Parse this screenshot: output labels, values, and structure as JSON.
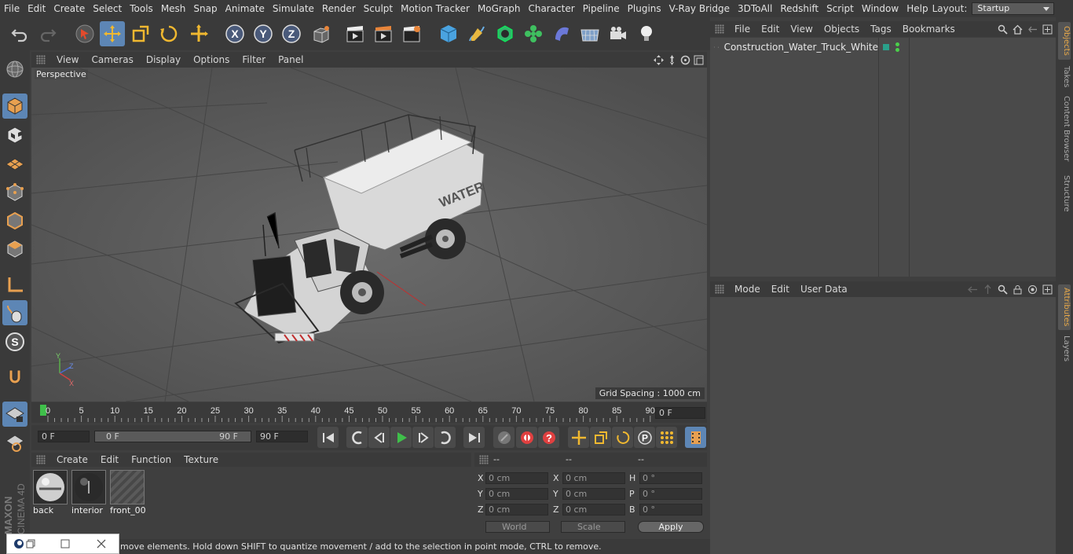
{
  "menu": [
    "File",
    "Edit",
    "Create",
    "Select",
    "Tools",
    "Mesh",
    "Snap",
    "Animate",
    "Simulate",
    "Render",
    "Sculpt",
    "Motion Tracker",
    "MoGraph",
    "Character",
    "Pipeline",
    "Plugins",
    "V-Ray Bridge",
    "3DToAll",
    "Redshift",
    "Script",
    "Window",
    "Help"
  ],
  "layout": {
    "label": "Layout:",
    "value": "Startup"
  },
  "viewport": {
    "menu": [
      "View",
      "Cameras",
      "Display",
      "Options",
      "Filter",
      "Panel"
    ],
    "camera_label": "Perspective",
    "grid_spacing": "Grid Spacing : 1000 cm",
    "tank_text": "WATER"
  },
  "timeline": {
    "ticks": [
      "0",
      "5",
      "10",
      "15",
      "20",
      "25",
      "30",
      "35",
      "40",
      "45",
      "50",
      "55",
      "60",
      "65",
      "70",
      "75",
      "80",
      "85",
      "90"
    ],
    "current_frame": "0 F"
  },
  "controls": {
    "start_field": "0 F",
    "range_start": "0 F",
    "range_end": "90 F",
    "end_field": "90 F"
  },
  "material_manager": {
    "menu": [
      "Create",
      "Edit",
      "Function",
      "Texture"
    ],
    "materials": [
      {
        "name": "back"
      },
      {
        "name": "interior"
      },
      {
        "name": "front_00"
      }
    ]
  },
  "coordinates": {
    "head": [
      "--",
      "--",
      "--"
    ],
    "rows": [
      {
        "a": "X",
        "av": "0 cm",
        "b": "X",
        "bv": "0 cm",
        "c": "H",
        "cv": "0 °"
      },
      {
        "a": "Y",
        "av": "0 cm",
        "b": "Y",
        "bv": "0 cm",
        "c": "P",
        "cv": "0 °"
      },
      {
        "a": "Z",
        "av": "0 cm",
        "b": "Z",
        "bv": "0 cm",
        "c": "B",
        "cv": "0 °"
      }
    ],
    "world": "World",
    "scale": "Scale",
    "apply": "Apply"
  },
  "status": "move elements. Hold down SHIFT to quantize movement / add to the selection in point mode, CTRL to remove.",
  "objects_panel": {
    "menu": [
      "File",
      "Edit",
      "View",
      "Objects",
      "Tags",
      "Bookmarks"
    ],
    "items": [
      {
        "name": "Construction_Water_Truck_White"
      }
    ]
  },
  "attributes_panel": {
    "menu": [
      "Mode",
      "Edit",
      "User Data"
    ]
  },
  "side_tabs": [
    "Objects",
    "Takes",
    "Content Browser",
    "Structure",
    "Attributes",
    "Layers"
  ],
  "brand": {
    "maxon": "MAXON",
    "product": "CINEMA 4D"
  },
  "colors": {
    "accent": "#5d86b5",
    "tab_active": "#e8a94a",
    "play": "#3fbf4a",
    "record": "#e04040"
  }
}
